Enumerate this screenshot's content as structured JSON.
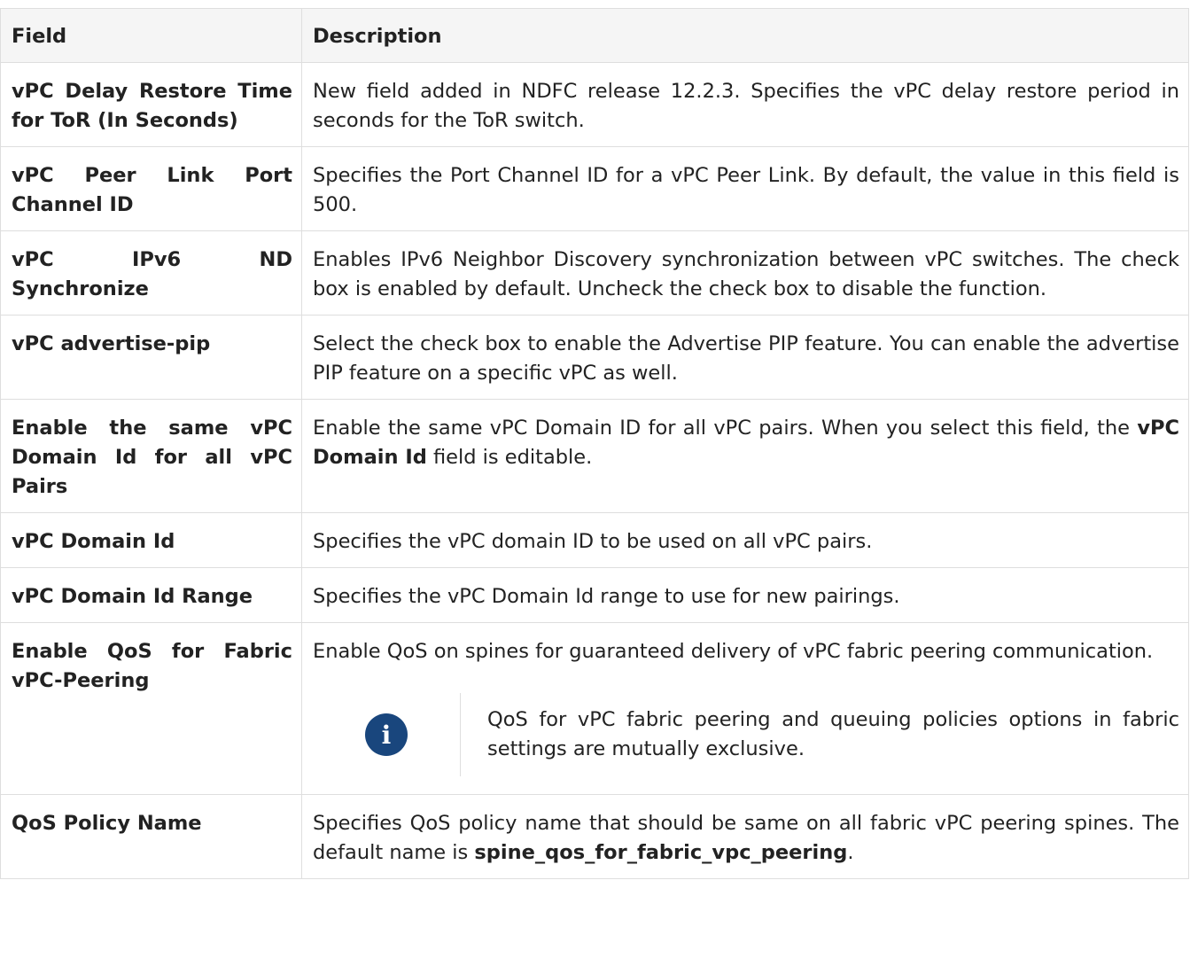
{
  "headers": {
    "field": "Field",
    "description": "Description"
  },
  "rows": [
    {
      "field": "vPC Delay Restore Time for ToR (In Seconds)",
      "description": "New field added in NDFC release 12.2.3. Specifies the vPC delay restore period in seconds for the ToR switch."
    },
    {
      "field": "vPC Peer Link Port Channel ID",
      "description": "Specifies the Port Channel ID for a vPC Peer Link. By default, the value in this field is 500."
    },
    {
      "field": "vPC IPv6 ND Synchronize",
      "description": "Enables IPv6 Neighbor Discovery synchronization between vPC switches. The check box is enabled by default. Uncheck the check box to disable the function."
    },
    {
      "field": "vPC advertise-pip",
      "description": "Select the check box to enable the Advertise PIP feature. You can enable the advertise PIP feature on a specific vPC as well."
    },
    {
      "field": "Enable the same vPC Domain Id for all vPC Pairs",
      "description_pre": "Enable the same vPC Domain ID for all vPC pairs. When you select this field, the ",
      "description_bold": "vPC Domain Id",
      "description_post": " field is editable."
    },
    {
      "field": "vPC Domain Id",
      "description": "Specifies the vPC domain ID to be used on all vPC pairs."
    },
    {
      "field": "vPC Domain Id Range",
      "description": "Specifies the vPC Domain Id range to use for new pairings."
    },
    {
      "field": "Enable QoS for Fabric vPC-Peering",
      "description": "Enable QoS on spines for guaranteed delivery of vPC fabric peering communication.",
      "note_icon": "info-icon",
      "note_icon_glyph": "i",
      "note": "QoS for vPC fabric peering and queuing policies options in fabric settings are mutually exclusive."
    },
    {
      "field": "QoS Policy Name",
      "description_pre": "Specifies QoS policy name that should be same on all fabric vPC peering spines. The default name is ",
      "description_bold": "spine_qos_for_fabric_vpc_peering",
      "description_post": "."
    }
  ],
  "colors": {
    "note_icon_bg": "#19467d",
    "header_bg": "#f5f5f5",
    "border": "#dedede"
  }
}
